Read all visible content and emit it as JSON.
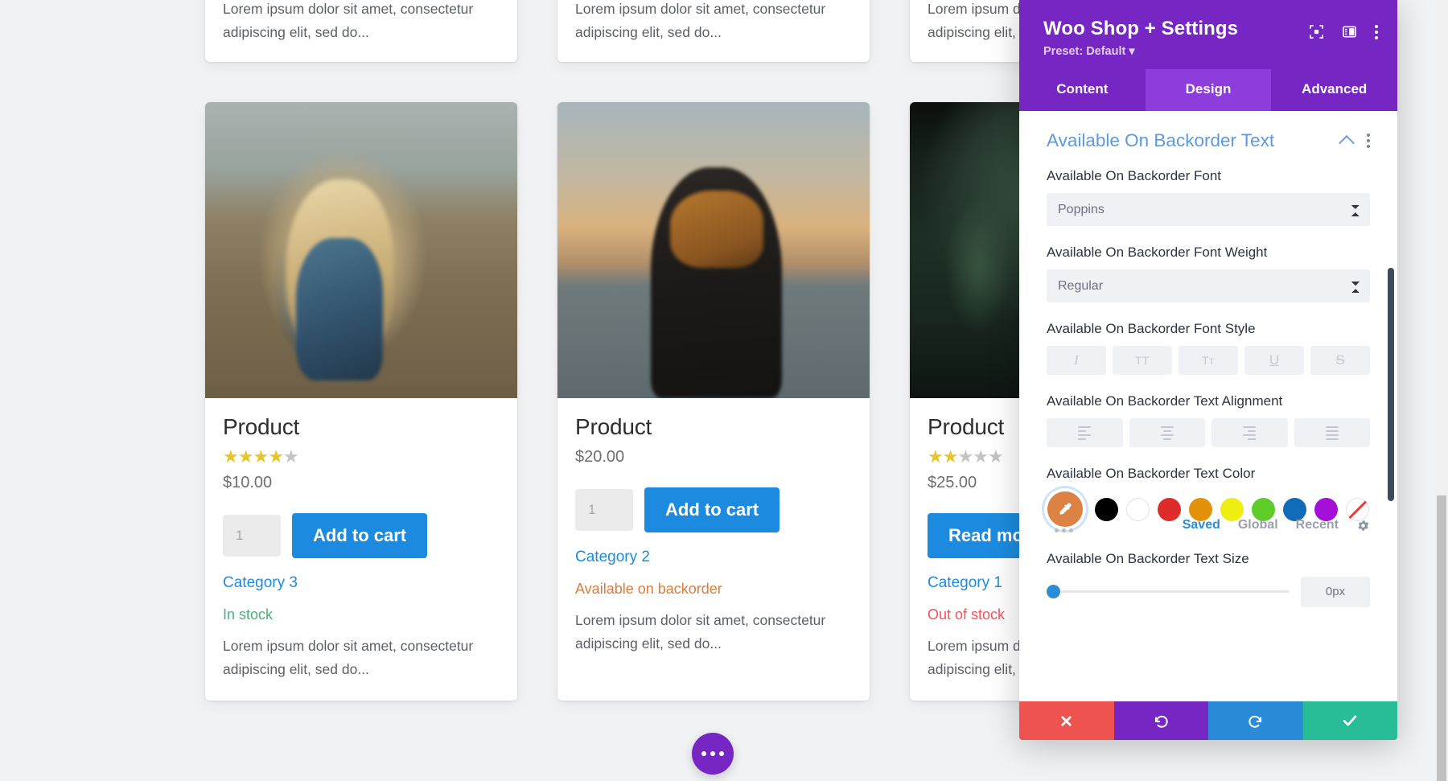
{
  "shop": {
    "top_row_cards": [
      {
        "excerpt": "Lorem ipsum dolor sit amet, consectetur adipiscing elit, sed do..."
      },
      {
        "excerpt": "Lorem ipsum dolor sit amet, consectetur adipiscing elit, sed do..."
      },
      {
        "excerpt": "Lorem ipsum dolor sit amet, consectetur adipiscing elit, sed do..."
      }
    ],
    "products": [
      {
        "title": "Product",
        "rating": 4,
        "price": "$10.00",
        "qty_value": "1",
        "button_label": "Add to cart",
        "category": "Category 3",
        "stock_label": "In stock",
        "stock_state": "instock",
        "excerpt": "Lorem ipsum dolor sit amet, consectetur adipiscing elit, sed do..."
      },
      {
        "title": "Product",
        "rating": 0,
        "price": "$20.00",
        "qty_value": "1",
        "button_label": "Add to cart",
        "category": "Category 2",
        "stock_label": "Available on backorder",
        "stock_state": "backorder",
        "excerpt": "Lorem ipsum dolor sit amet, consectetur adipiscing elit, sed do..."
      },
      {
        "title": "Product",
        "rating": 2,
        "price": "$25.00",
        "qty_value": "",
        "button_label": "Read more",
        "category": "Category 1",
        "stock_label": "Out of stock",
        "stock_state": "outstock",
        "excerpt": "Lorem ipsum dolor sit amet, consectetur adipiscing elit, sed do..."
      }
    ],
    "fab": {
      "icon": "ellipsis-horizontal-icon"
    }
  },
  "modal": {
    "title": "Woo Shop + Settings",
    "preset": "Preset: Default",
    "header_icons": [
      "focus-target-icon",
      "panel-layout-icon",
      "kebab-menu-icon"
    ],
    "tabs": [
      {
        "label": "Content",
        "active": false
      },
      {
        "label": "Design",
        "active": true
      },
      {
        "label": "Advanced",
        "active": false
      }
    ],
    "section": {
      "title": "Available On Backorder Text",
      "collapse_icon": "chevron-up-icon",
      "menu_icon": "kebab-menu-icon"
    },
    "fields": {
      "font": {
        "label": "Available On Backorder Font",
        "value": "Poppins"
      },
      "font_weight": {
        "label": "Available On Backorder Font Weight",
        "value": "Regular"
      },
      "font_style": {
        "label": "Available On Backorder Font Style",
        "options": [
          {
            "glyph": "I",
            "name": "italic"
          },
          {
            "glyph": "TT",
            "name": "uppercase"
          },
          {
            "glyph": "Tᴛ",
            "name": "capitalize"
          },
          {
            "glyph": "U",
            "name": "underline"
          },
          {
            "glyph": "S",
            "name": "strikethrough"
          }
        ]
      },
      "text_alignment": {
        "label": "Available On Backorder Text Alignment",
        "options": [
          "align-left",
          "align-center",
          "align-right",
          "align-justify"
        ]
      },
      "text_color": {
        "label": "Available On Backorder Text Color",
        "selected": "#dd8245",
        "eyedropper_icon": "eyedropper-icon",
        "swatches": [
          {
            "name": "black",
            "hex": "#000000"
          },
          {
            "name": "white",
            "hex": "#ffffff"
          },
          {
            "name": "red",
            "hex": "#e02b2b"
          },
          {
            "name": "orange",
            "hex": "#e29108"
          },
          {
            "name": "yellow",
            "hex": "#eeee12"
          },
          {
            "name": "green",
            "hex": "#5ecd29"
          },
          {
            "name": "blue",
            "hex": "#106cb9"
          },
          {
            "name": "purple",
            "hex": "#a410d8"
          },
          {
            "name": "transparent",
            "hex": "none"
          }
        ],
        "more_icon": "ellipsis-horizontal-icon",
        "palette_tabs": [
          {
            "label": "Saved",
            "active": true
          },
          {
            "label": "Global",
            "active": false
          },
          {
            "label": "Recent",
            "active": false
          }
        ],
        "settings_icon": "gear-icon"
      },
      "text_size": {
        "label": "Available On Backorder Text Size",
        "value": "0px",
        "slider_percent": 0
      }
    },
    "footer": [
      {
        "name": "cancel-button",
        "icon": "close-icon",
        "color": "#ef5350"
      },
      {
        "name": "undo-button",
        "icon": "undo-icon",
        "color": "#7526c3"
      },
      {
        "name": "redo-button",
        "icon": "redo-icon",
        "color": "#2a8bd8"
      },
      {
        "name": "save-button",
        "icon": "check-icon",
        "color": "#28bd96"
      }
    ]
  }
}
